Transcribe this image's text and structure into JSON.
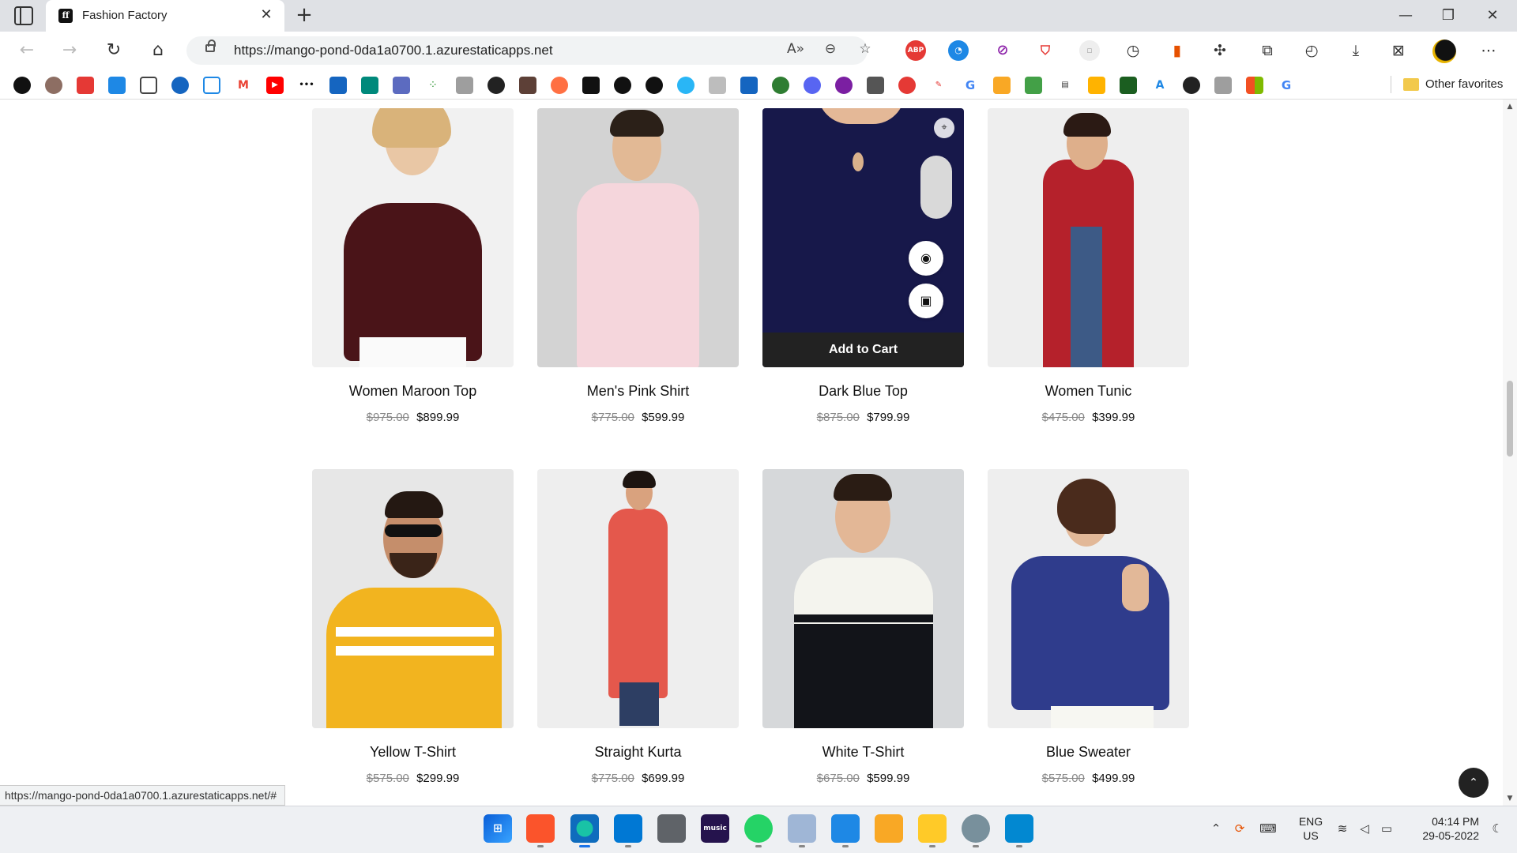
{
  "browser": {
    "tab_title": "Fashion Factory",
    "tab_favicon": "ff",
    "url": "https://mango-pond-0da1a0700.1.azurestaticapps.net",
    "status_url": "https://mango-pond-0da1a0700.1.azurestaticapps.net/#",
    "other_favorites": "Other favorites",
    "ext_abp": "ABP"
  },
  "products": [
    {
      "name": "Women Maroon Top",
      "old_price": "$975.00",
      "price": "$899.99"
    },
    {
      "name": "Men's Pink Shirt",
      "old_price": "$775.00",
      "price": "$599.99"
    },
    {
      "name": "Dark Blue Top",
      "old_price": "$875.00",
      "price": "$799.99",
      "hovered": true
    },
    {
      "name": "Women Tunic",
      "old_price": "$475.00",
      "price": "$399.99"
    },
    {
      "name": "Yellow T-Shirt",
      "old_price": "$575.00",
      "price": "$299.99"
    },
    {
      "name": "Straight Kurta",
      "old_price": "$775.00",
      "price": "$699.99"
    },
    {
      "name": "White T-Shirt",
      "old_price": "$675.00",
      "price": "$599.99"
    },
    {
      "name": "Blue Sweater",
      "old_price": "$575.00",
      "price": "$499.99"
    }
  ],
  "hover_actions": {
    "add_to_cart": "Add to Cart",
    "quick_view_icon": "eye-icon",
    "bag_icon": "shopping-bag-icon"
  },
  "taskbar": {
    "language_line1": "ENG",
    "language_line2": "US",
    "time": "04:14 PM",
    "date": "29-05-2022",
    "music_label": "music"
  },
  "colors": {
    "page_bg": "#ffffff",
    "add_to_cart_bg": "#222222",
    "old_price": "#888888",
    "scroll_top_bg": "#222222"
  }
}
